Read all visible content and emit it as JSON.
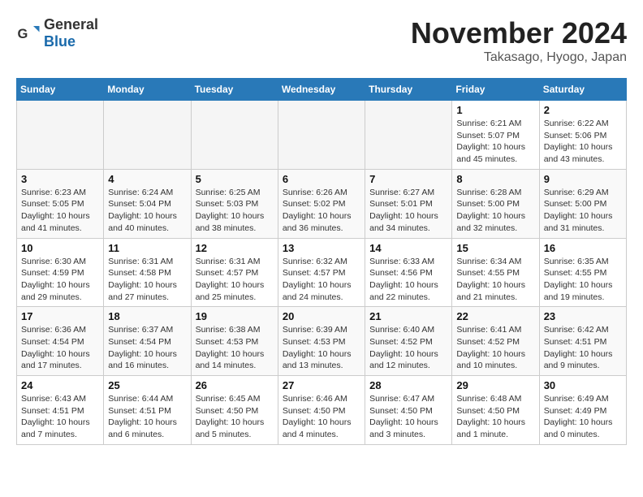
{
  "header": {
    "logo_general": "General",
    "logo_blue": "Blue",
    "month": "November 2024",
    "location": "Takasago, Hyogo, Japan"
  },
  "weekdays": [
    "Sunday",
    "Monday",
    "Tuesday",
    "Wednesday",
    "Thursday",
    "Friday",
    "Saturday"
  ],
  "weeks": [
    [
      {
        "day": "",
        "info": ""
      },
      {
        "day": "",
        "info": ""
      },
      {
        "day": "",
        "info": ""
      },
      {
        "day": "",
        "info": ""
      },
      {
        "day": "",
        "info": ""
      },
      {
        "day": "1",
        "info": "Sunrise: 6:21 AM\nSunset: 5:07 PM\nDaylight: 10 hours\nand 45 minutes."
      },
      {
        "day": "2",
        "info": "Sunrise: 6:22 AM\nSunset: 5:06 PM\nDaylight: 10 hours\nand 43 minutes."
      }
    ],
    [
      {
        "day": "3",
        "info": "Sunrise: 6:23 AM\nSunset: 5:05 PM\nDaylight: 10 hours\nand 41 minutes."
      },
      {
        "day": "4",
        "info": "Sunrise: 6:24 AM\nSunset: 5:04 PM\nDaylight: 10 hours\nand 40 minutes."
      },
      {
        "day": "5",
        "info": "Sunrise: 6:25 AM\nSunset: 5:03 PM\nDaylight: 10 hours\nand 38 minutes."
      },
      {
        "day": "6",
        "info": "Sunrise: 6:26 AM\nSunset: 5:02 PM\nDaylight: 10 hours\nand 36 minutes."
      },
      {
        "day": "7",
        "info": "Sunrise: 6:27 AM\nSunset: 5:01 PM\nDaylight: 10 hours\nand 34 minutes."
      },
      {
        "day": "8",
        "info": "Sunrise: 6:28 AM\nSunset: 5:00 PM\nDaylight: 10 hours\nand 32 minutes."
      },
      {
        "day": "9",
        "info": "Sunrise: 6:29 AM\nSunset: 5:00 PM\nDaylight: 10 hours\nand 31 minutes."
      }
    ],
    [
      {
        "day": "10",
        "info": "Sunrise: 6:30 AM\nSunset: 4:59 PM\nDaylight: 10 hours\nand 29 minutes."
      },
      {
        "day": "11",
        "info": "Sunrise: 6:31 AM\nSunset: 4:58 PM\nDaylight: 10 hours\nand 27 minutes."
      },
      {
        "day": "12",
        "info": "Sunrise: 6:31 AM\nSunset: 4:57 PM\nDaylight: 10 hours\nand 25 minutes."
      },
      {
        "day": "13",
        "info": "Sunrise: 6:32 AM\nSunset: 4:57 PM\nDaylight: 10 hours\nand 24 minutes."
      },
      {
        "day": "14",
        "info": "Sunrise: 6:33 AM\nSunset: 4:56 PM\nDaylight: 10 hours\nand 22 minutes."
      },
      {
        "day": "15",
        "info": "Sunrise: 6:34 AM\nSunset: 4:55 PM\nDaylight: 10 hours\nand 21 minutes."
      },
      {
        "day": "16",
        "info": "Sunrise: 6:35 AM\nSunset: 4:55 PM\nDaylight: 10 hours\nand 19 minutes."
      }
    ],
    [
      {
        "day": "17",
        "info": "Sunrise: 6:36 AM\nSunset: 4:54 PM\nDaylight: 10 hours\nand 17 minutes."
      },
      {
        "day": "18",
        "info": "Sunrise: 6:37 AM\nSunset: 4:54 PM\nDaylight: 10 hours\nand 16 minutes."
      },
      {
        "day": "19",
        "info": "Sunrise: 6:38 AM\nSunset: 4:53 PM\nDaylight: 10 hours\nand 14 minutes."
      },
      {
        "day": "20",
        "info": "Sunrise: 6:39 AM\nSunset: 4:53 PM\nDaylight: 10 hours\nand 13 minutes."
      },
      {
        "day": "21",
        "info": "Sunrise: 6:40 AM\nSunset: 4:52 PM\nDaylight: 10 hours\nand 12 minutes."
      },
      {
        "day": "22",
        "info": "Sunrise: 6:41 AM\nSunset: 4:52 PM\nDaylight: 10 hours\nand 10 minutes."
      },
      {
        "day": "23",
        "info": "Sunrise: 6:42 AM\nSunset: 4:51 PM\nDaylight: 10 hours\nand 9 minutes."
      }
    ],
    [
      {
        "day": "24",
        "info": "Sunrise: 6:43 AM\nSunset: 4:51 PM\nDaylight: 10 hours\nand 7 minutes."
      },
      {
        "day": "25",
        "info": "Sunrise: 6:44 AM\nSunset: 4:51 PM\nDaylight: 10 hours\nand 6 minutes."
      },
      {
        "day": "26",
        "info": "Sunrise: 6:45 AM\nSunset: 4:50 PM\nDaylight: 10 hours\nand 5 minutes."
      },
      {
        "day": "27",
        "info": "Sunrise: 6:46 AM\nSunset: 4:50 PM\nDaylight: 10 hours\nand 4 minutes."
      },
      {
        "day": "28",
        "info": "Sunrise: 6:47 AM\nSunset: 4:50 PM\nDaylight: 10 hours\nand 3 minutes."
      },
      {
        "day": "29",
        "info": "Sunrise: 6:48 AM\nSunset: 4:50 PM\nDaylight: 10 hours\nand 1 minute."
      },
      {
        "day": "30",
        "info": "Sunrise: 6:49 AM\nSunset: 4:49 PM\nDaylight: 10 hours\nand 0 minutes."
      }
    ]
  ]
}
